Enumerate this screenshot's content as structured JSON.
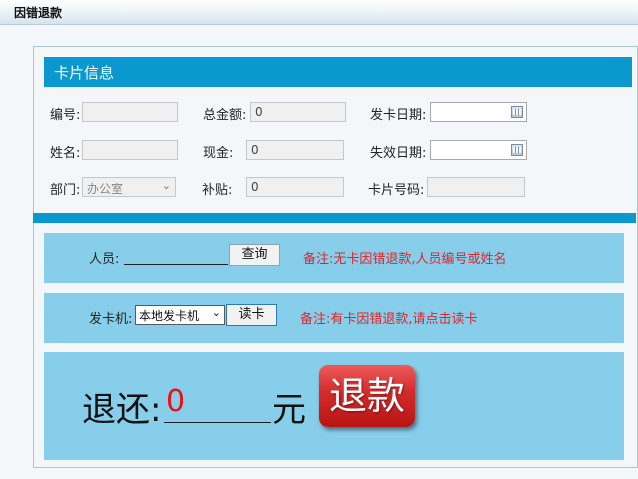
{
  "window": {
    "title": "因错退款"
  },
  "card_info": {
    "header": "卡片信息",
    "number_label": "编号:",
    "number_value": "",
    "total_label": "总金额:",
    "total_value": "0",
    "issue_date_label": "发卡日期:",
    "issue_date_value": "",
    "name_label": "姓名:",
    "name_value": "",
    "cash_label": "现金:",
    "cash_value": "0",
    "expire_date_label": "失效日期:",
    "expire_date_value": "",
    "dept_label": "部门:",
    "dept_value": "办公室",
    "subsidy_label": "补贴:",
    "subsidy_value": "0",
    "card_no_label": "卡片号码:",
    "card_no_value": ""
  },
  "query_panel": {
    "person_label": "人员:",
    "person_value": "",
    "query_button": "查询",
    "note": "备注:无卡因错退款,人员编号或姓名"
  },
  "card_panel": {
    "machine_label": "发卡机:",
    "machine_selected": "本地发卡机",
    "read_button": "读卡",
    "note": "备注:有卡因错退款,请点击读卡"
  },
  "refund_panel": {
    "refund_label": "退还:",
    "amount": "0",
    "unit": "元",
    "refund_button": "退款"
  },
  "colors": {
    "header_blue": "#0999cf",
    "panel_blue": "#87ceeb",
    "note_red": "#e0242a",
    "refund_red": "#d42a2a"
  }
}
